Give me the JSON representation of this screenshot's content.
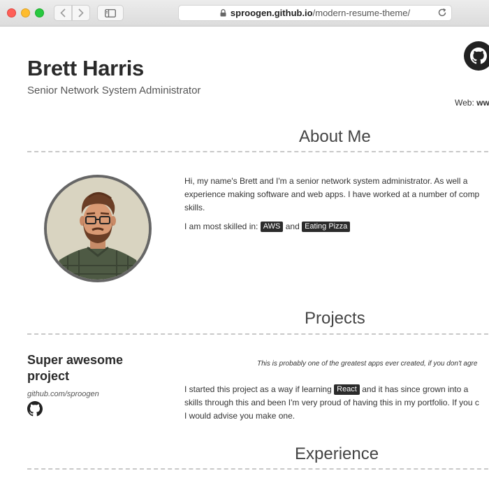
{
  "browser": {
    "url_host": "sproogen.github.io",
    "url_path": "/modern-resume-theme/"
  },
  "header": {
    "name": "Brett Harris",
    "title": "Senior Network System Administrator",
    "web_label": "Web:",
    "web_value": "ww"
  },
  "about": {
    "heading": "About Me",
    "line1": "Hi, my name's Brett and I'm a senior network system administrator. As well a",
    "line2": "experience making software and web apps. I have worked at a number of comp",
    "line3": "skills.",
    "skills_prefix": "I am most skilled in:",
    "skills": [
      "AWS",
      "Eating Pizza"
    ],
    "skills_joiner": "and"
  },
  "projects": {
    "heading": "Projects",
    "items": [
      {
        "title": "Super awesome project",
        "link": "github.com/sproogen",
        "quote": "This is probably one of the greatest apps ever created, if you don't agre",
        "desc_prefix": "I started this project as a way if learning",
        "desc_tag": "React",
        "desc_suffix": "and it has since grown into a",
        "desc_line2": "skills through this and been I'm very proud of having this in my portfolio. If you c",
        "desc_line3": "I would advise you make one."
      }
    ]
  },
  "experience": {
    "heading": "Experience"
  },
  "colors": {
    "tag_bg": "#2b2b2b",
    "divider": "#c8c8c8"
  }
}
